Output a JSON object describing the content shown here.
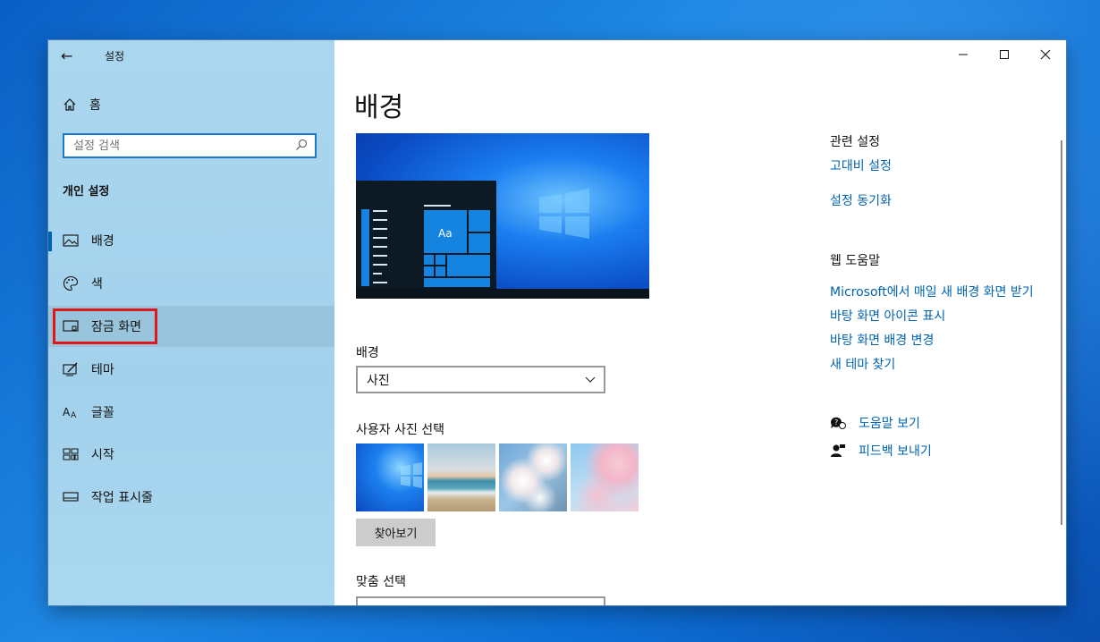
{
  "window": {
    "title": "설정",
    "back_icon": "back-arrow-icon",
    "controls": [
      "minimize",
      "maximize",
      "close"
    ]
  },
  "sidebar": {
    "home_label": "홈",
    "search_placeholder": "설정 검색",
    "section_heading": "개인 설정",
    "items": [
      {
        "label": "배경",
        "icon": "picture-icon",
        "active": true
      },
      {
        "label": "색",
        "icon": "palette-icon"
      },
      {
        "label": "잠금 화면",
        "icon": "lock-screen-icon",
        "selected": true
      },
      {
        "label": "테마",
        "icon": "theme-icon"
      },
      {
        "label": "글꼴",
        "icon": "font-icon"
      },
      {
        "label": "시작",
        "icon": "start-icon"
      },
      {
        "label": "작업 표시줄",
        "icon": "taskbar-icon"
      }
    ]
  },
  "main": {
    "title": "배경",
    "preview_sample_text": "Aa",
    "background_label": "배경",
    "background_value": "사진",
    "choose_photo_label": "사용자 사진 선택",
    "browse_label": "찾아보기",
    "fit_label": "맞춤 선택"
  },
  "related": {
    "heading": "관련 설정",
    "links": [
      "고대비 설정",
      "설정 동기화"
    ],
    "web_help_heading": "웹 도움말",
    "web_links": [
      "Microsoft에서 매일 새 배경 화면 받기",
      "바탕 화면 아이콘 표시",
      "바탕 화면 배경 변경",
      "새 테마 찾기"
    ],
    "help_label": "도움말 보기",
    "feedback_label": "피드백 보내기"
  },
  "colors": {
    "accent": "#0063b1",
    "highlight_box": "#e0161b",
    "sidebar": "#abd6ee"
  }
}
